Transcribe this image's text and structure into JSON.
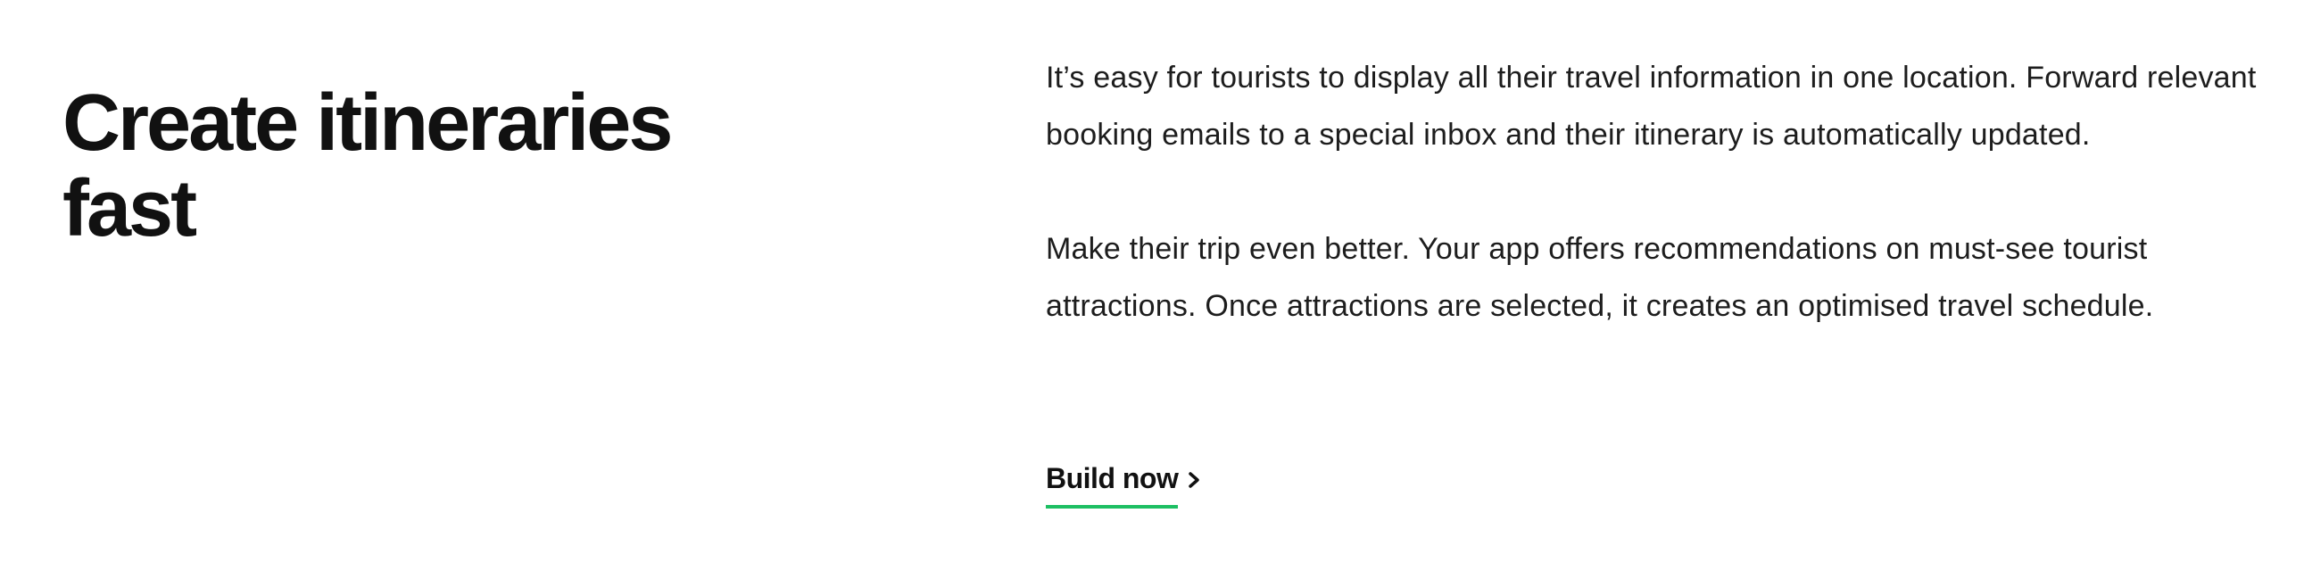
{
  "section": {
    "heading_line1": "Create itineraries",
    "heading_line2": "fast",
    "paragraph1": "It’s easy for tourists to display all their travel information in one location. Forward relevant booking emails to a special inbox and their itinerary is automatically updated.",
    "paragraph2": "Make their trip even better. Your app offers recommendations on must-see tourist attractions. Once attractions are selected, it creates an optimised travel schedule.",
    "cta_label": "Build now",
    "cta_icon": "chevron-right-icon",
    "accent_color": "#1dbf63"
  }
}
